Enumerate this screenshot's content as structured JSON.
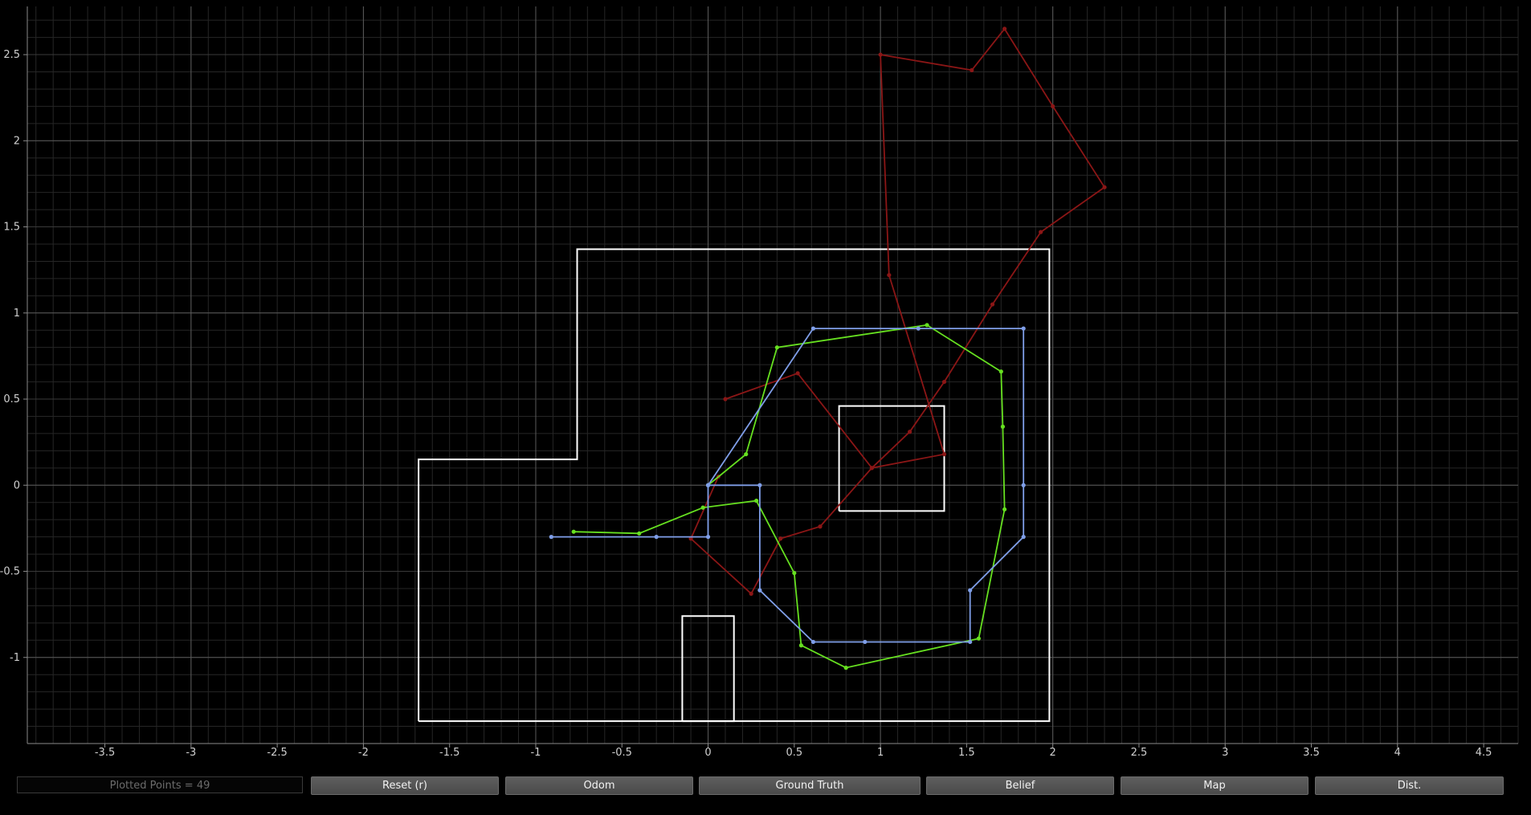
{
  "plot": {
    "background": "#000000",
    "x_ticks": [
      "-3.5",
      "-3",
      "-2.5",
      "-2",
      "-1.5",
      "-1",
      "-0.5",
      "0",
      "0.5",
      "1",
      "1.5",
      "2",
      "2.5",
      "3",
      "3.5",
      "4",
      "4.5"
    ],
    "y_ticks": [
      "2.5",
      "2",
      "1.5",
      "1",
      "0.5",
      "0",
      "-0.5",
      "-1"
    ],
    "grid": "on",
    "colors": {
      "map": "#ffffff",
      "odom": "#8b1616",
      "ground_truth": "#66e020",
      "belief": "#7f9ee8",
      "major_grid": "#5a5a5a",
      "minor_grid": "#262626"
    }
  },
  "chart_data": {
    "type": "line",
    "xlim": [
      -3.95,
      4.7
    ],
    "ylim": [
      -1.5,
      2.78
    ],
    "map": [
      [
        [
          -1.68,
          -1.37
        ],
        [
          1.98,
          -1.37
        ],
        [
          1.98,
          1.37
        ],
        [
          -0.76,
          1.37
        ],
        [
          -0.76,
          0.15
        ],
        [
          -1.68,
          0.15
        ],
        [
          -1.68,
          -1.37
        ]
      ],
      [
        [
          0.76,
          -0.15
        ],
        [
          1.37,
          -0.15
        ],
        [
          1.37,
          0.46
        ],
        [
          0.76,
          0.46
        ],
        [
          0.76,
          -0.15
        ]
      ],
      [
        [
          -0.15,
          -1.37
        ],
        [
          0.15,
          -1.37
        ],
        [
          0.15,
          -0.76
        ],
        [
          -0.15,
          -0.76
        ],
        [
          -0.15,
          -1.37
        ]
      ]
    ],
    "series": [
      {
        "key": "odom",
        "points": [
          [
            0.1,
            0.5
          ],
          [
            0.52,
            0.65
          ],
          [
            0.95,
            0.1
          ],
          [
            1.37,
            0.18
          ],
          [
            1.05,
            1.22
          ],
          [
            1.0,
            2.5
          ],
          [
            1.53,
            2.41
          ],
          [
            1.72,
            2.65
          ],
          [
            2.0,
            2.2
          ],
          [
            2.3,
            1.73
          ],
          [
            1.93,
            1.47
          ],
          [
            1.65,
            1.05
          ],
          [
            1.37,
            0.6
          ],
          [
            1.17,
            0.31
          ],
          [
            0.95,
            0.1
          ],
          [
            0.65,
            -0.24
          ],
          [
            0.42,
            -0.31
          ],
          [
            0.25,
            -0.63
          ],
          [
            -0.1,
            -0.31
          ],
          [
            0.06,
            0.05
          ]
        ]
      },
      {
        "key": "ground_truth",
        "points": [
          [
            -0.78,
            -0.27
          ],
          [
            -0.4,
            -0.28
          ],
          [
            -0.03,
            -0.13
          ],
          [
            0.28,
            -0.09
          ],
          [
            0.5,
            -0.51
          ],
          [
            0.54,
            -0.93
          ],
          [
            0.8,
            -1.06
          ],
          [
            1.57,
            -0.89
          ],
          [
            1.72,
            -0.14
          ],
          [
            1.71,
            0.34
          ],
          [
            1.7,
            0.66
          ],
          [
            1.27,
            0.93
          ],
          [
            0.4,
            0.8
          ],
          [
            0.22,
            0.18
          ],
          [
            0.0,
            0.0
          ]
        ]
      },
      {
        "key": "belief",
        "points": [
          [
            -0.91,
            -0.3
          ],
          [
            -0.3,
            -0.3
          ],
          [
            0.0,
            -0.3
          ],
          [
            0.0,
            0.0
          ],
          [
            0.3,
            0.0
          ],
          [
            0.3,
            -0.61
          ],
          [
            0.61,
            -0.91
          ],
          [
            0.91,
            -0.91
          ],
          [
            1.52,
            -0.91
          ],
          [
            1.52,
            -0.61
          ],
          [
            1.83,
            -0.3
          ],
          [
            1.83,
            0.0
          ],
          [
            1.83,
            0.91
          ],
          [
            1.22,
            0.91
          ],
          [
            0.61,
            0.91
          ],
          [
            0.0,
            0.0
          ]
        ]
      }
    ]
  },
  "toolbar": {
    "plotted_points": "Plotted Points = 49",
    "reset": "Reset (r)",
    "odom": "Odom",
    "ground_truth": "Ground Truth",
    "belief": "Belief",
    "map": "Map",
    "dist": "Dist."
  }
}
